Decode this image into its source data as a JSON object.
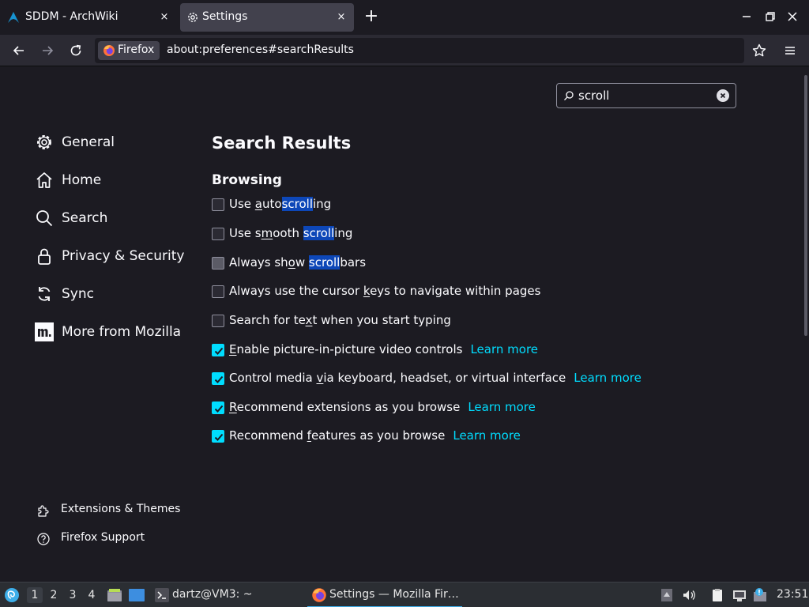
{
  "tabs": [
    {
      "title": "SDDM - ArchWiki",
      "close": "×"
    },
    {
      "title": "Settings",
      "close": "×"
    }
  ],
  "new_tab": "+",
  "identity_label": "Firefox",
  "url": "about:preferences#searchResults",
  "search": {
    "value": "scroll"
  },
  "categories": [
    {
      "label": "General"
    },
    {
      "label": "Home"
    },
    {
      "label": "Search"
    },
    {
      "label": "Privacy & Security"
    },
    {
      "label": "Sync"
    },
    {
      "label": "More from Mozilla"
    }
  ],
  "footer": [
    {
      "label": "Extensions & Themes"
    },
    {
      "label": "Firefox Support"
    }
  ],
  "page_title": "Search Results",
  "section_title": "Browsing",
  "options": [
    {
      "p1": "Use ",
      "k": "a",
      "p2": "uto",
      "h": "scroll",
      "p3": "ing",
      "checked": false,
      "disabled": false
    },
    {
      "p1": "Use s",
      "k": "m",
      "p2": "ooth ",
      "h": "scroll",
      "p3": "ing",
      "checked": false,
      "disabled": false
    },
    {
      "p1": "Always sh",
      "k": "o",
      "p2": "w ",
      "h": "scroll",
      "p3": "bars",
      "checked": false,
      "disabled": true
    },
    {
      "p1": "Always use the cursor ",
      "k": "k",
      "p2": "eys to navigate within pages",
      "checked": false,
      "disabled": false
    },
    {
      "p1": "Search for te",
      "k": "x",
      "p2": "t when you start typing",
      "checked": false,
      "disabled": false
    },
    {
      "p1": "",
      "k": "E",
      "p2": "nable picture-in-picture video controls",
      "learn": "Learn more",
      "checked": true,
      "disabled": false
    },
    {
      "p1": "Control media ",
      "k": "v",
      "p2": "ia keyboard, headset, or virtual interface",
      "learn": "Learn more",
      "checked": true,
      "disabled": false
    },
    {
      "p1": "",
      "k": "R",
      "p2": "ecommend extensions as you browse",
      "learn": "Learn more",
      "checked": true,
      "disabled": false
    },
    {
      "p1": "Recommend ",
      "k": "f",
      "p2": "eatures as you browse",
      "learn": "Learn more",
      "checked": true,
      "disabled": false
    }
  ],
  "taskbar": {
    "workspaces": [
      "1",
      "2",
      "3",
      "4"
    ],
    "terminal_task": "dartz@VM3: ~",
    "firefox_task": "Settings — Mozilla Fir…",
    "clock": "23:51"
  },
  "colors": {
    "accent": "#00ddff",
    "highlight": "#0d47b8",
    "background": "#1c1b22"
  }
}
